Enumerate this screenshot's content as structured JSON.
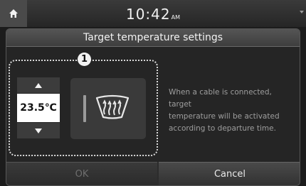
{
  "status_bar": {
    "time": "10:42",
    "ampm": "AM",
    "home_icon": "home-icon"
  },
  "dialog": {
    "title": "Target temperature settings",
    "callout_number": "1",
    "temperature": {
      "value": "23.5℃",
      "up_icon": "triangle-up-icon",
      "down_icon": "triangle-down-icon"
    },
    "defrost": {
      "icon": "rear-defrost-icon"
    },
    "info_lines": [
      "When a cable is connected,",
      "target",
      "temperature will be activated",
      "according to departure time."
    ],
    "ok_label": "OK",
    "cancel_label": "Cancel"
  },
  "colors": {
    "background": "#1c1c1c",
    "panel": "#2c2c2c",
    "text": "#e8e8e8",
    "disabled_text": "#6e6e6e",
    "info_text": "#9e9e9e"
  }
}
